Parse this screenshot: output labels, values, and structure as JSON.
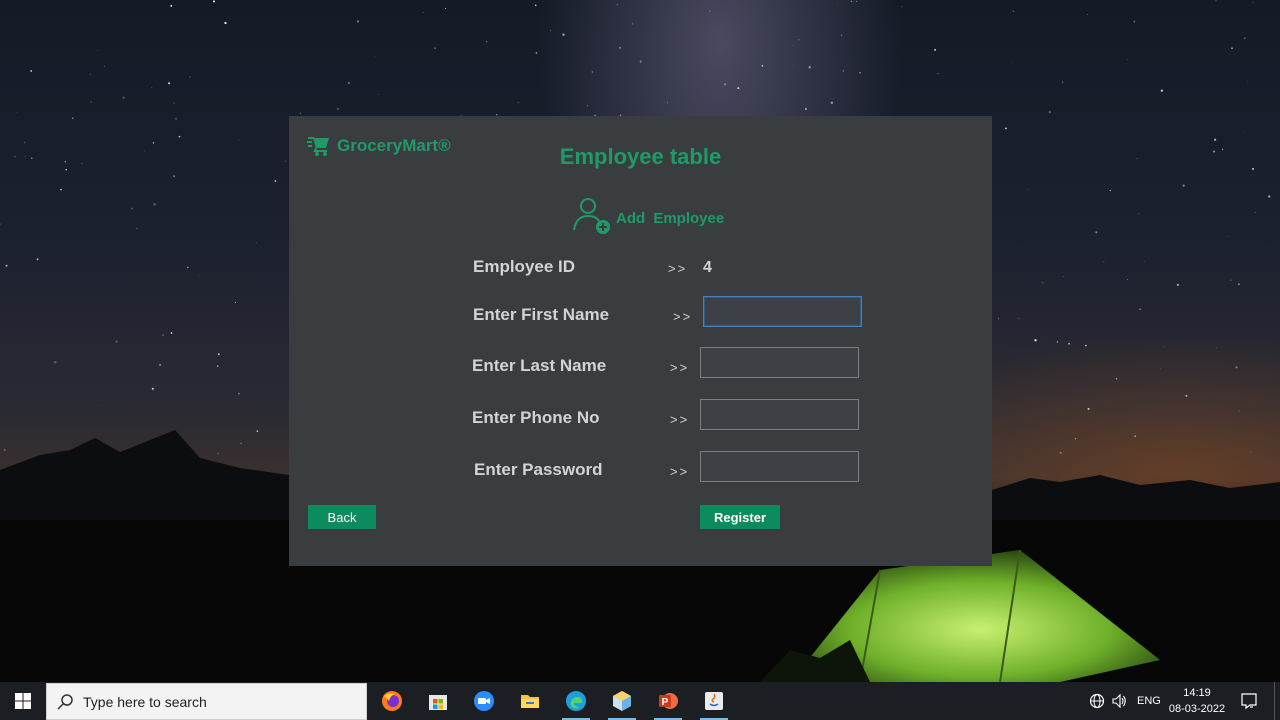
{
  "app": {
    "brand": "GroceryMart®",
    "title": "Employee table",
    "section_label": "Add  Employee"
  },
  "form": {
    "employee_id_label": "Employee ID",
    "employee_id_value": "4",
    "arrow": ">>",
    "first_name_label": "Enter First Name",
    "last_name_label": "Enter Last Name",
    "phone_label": "Enter Phone No",
    "password_label": "Enter Password",
    "first_name_value": "",
    "last_name_value": "",
    "phone_value": "",
    "password_value": ""
  },
  "buttons": {
    "back": "Back",
    "register": "Register"
  },
  "taskbar": {
    "search_placeholder": "Type here to search",
    "apps": [
      "firefox-icon",
      "microsoft-store-icon",
      "zoom-icon",
      "file-explorer-icon",
      "edge-icon",
      "netbeans-icon",
      "powerpoint-icon",
      "java-icon"
    ],
    "language": "ENG",
    "time": "14:19",
    "date": "08-03-2022"
  },
  "colors": {
    "accent_green": "#1d9b68",
    "button_green": "#0b8b5e",
    "window_bg": "#3a3d40",
    "label_text": "#d3d3d3",
    "taskbar_bg": "#1b1e22"
  }
}
